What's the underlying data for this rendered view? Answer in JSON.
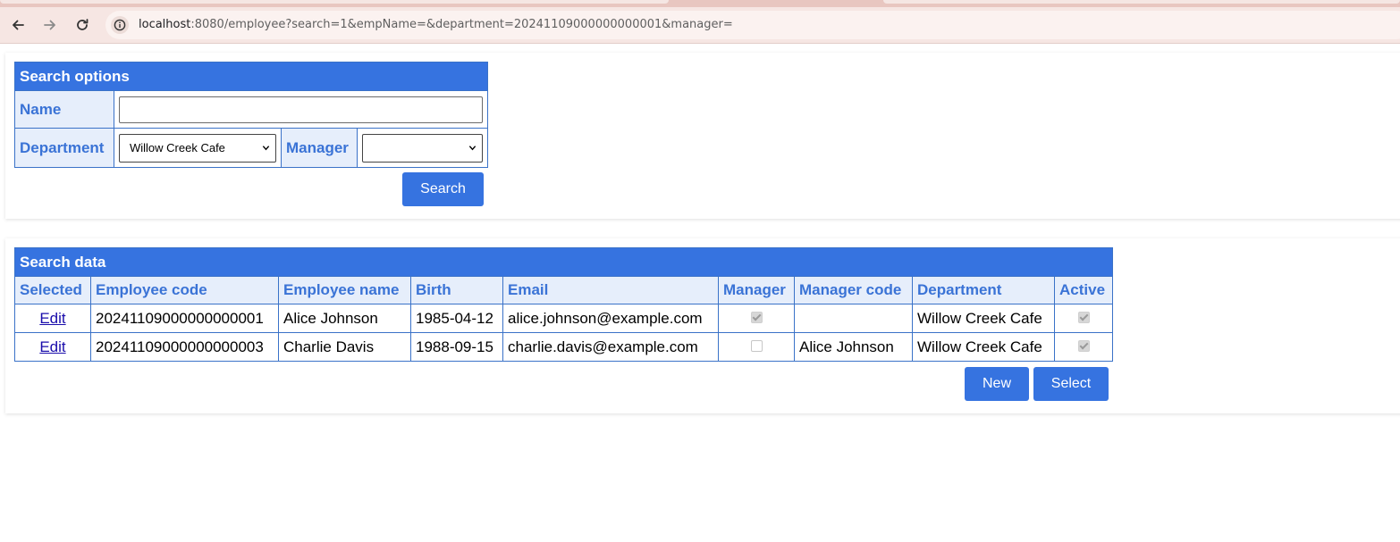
{
  "browser": {
    "url_host": "localhost",
    "url_rest": ":8080/employee?search=1&empName=&department=20241109000000000001&manager="
  },
  "search_options": {
    "title": "Search options",
    "name_label": "Name",
    "name_value": "",
    "department_label": "Department",
    "department_selected": "Willow Creek Cafe",
    "manager_label": "Manager",
    "manager_selected": "",
    "search_button": "Search"
  },
  "search_data": {
    "title": "Search data",
    "columns": [
      "Selected",
      "Employee code",
      "Employee name",
      "Birth",
      "Email",
      "Manager",
      "Manager code",
      "Department",
      "Active"
    ],
    "rows": [
      {
        "action": "Edit",
        "code": "20241109000000000001",
        "name": "Alice Johnson",
        "birth": "1985-04-12",
        "email": "alice.johnson@example.com",
        "manager": true,
        "manager_code": "",
        "department": "Willow Creek Cafe",
        "active": true
      },
      {
        "action": "Edit",
        "code": "20241109000000000003",
        "name": "Charlie Davis",
        "birth": "1988-09-15",
        "email": "charlie.davis@example.com",
        "manager": false,
        "manager_code": "Alice Johnson",
        "department": "Willow Creek Cafe",
        "active": true
      }
    ],
    "new_button": "New",
    "select_button": "Select"
  }
}
